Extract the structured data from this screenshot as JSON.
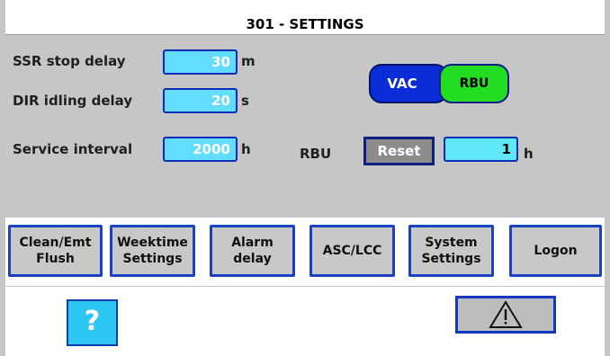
{
  "header": {
    "title": "301 - SETTINGS"
  },
  "settings": {
    "ssr_stop_delay": {
      "label": "SSR stop delay",
      "value": "30",
      "unit": "m"
    },
    "dir_idling_delay": {
      "label": "DIR idling delay",
      "value": "20",
      "unit": "s"
    },
    "service_interval": {
      "label": "Service interval",
      "value": "2000",
      "unit": "h"
    },
    "rbu": {
      "label": "RBU",
      "reset_label": "Reset",
      "value": "1",
      "unit": "h"
    }
  },
  "mode_toggle": {
    "vac_label": "VAC",
    "rbu_label": "RBU",
    "active": "RBU"
  },
  "nav": {
    "clean_flush": "Clean/Emt\nFlush",
    "weektime": "Weektime\nSettings",
    "alarm_delay": "Alarm\ndelay",
    "asc_lcc": "ASC/LCC",
    "system": "System\nSettings",
    "logon": "Logon"
  },
  "footer": {
    "help_label": "?",
    "alarm_icon": "warning-triangle-icon"
  },
  "colors": {
    "field_bg": "#62dcff",
    "field_border": "#0c2db6",
    "vac_active": "#0a2dd8",
    "rbu_active": "#22dd22",
    "panel_bg": "#c6c6c6"
  }
}
